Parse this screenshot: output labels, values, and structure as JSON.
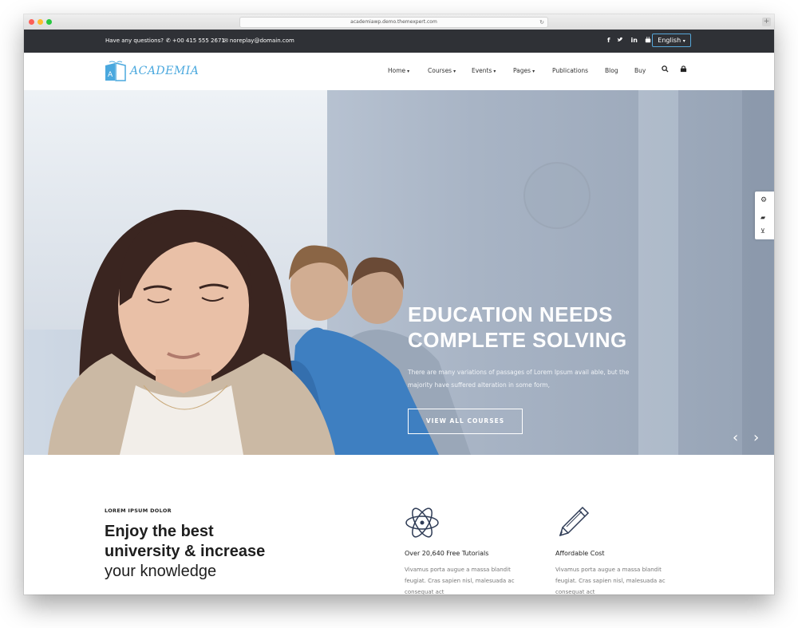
{
  "browser": {
    "url": "academiawp.demo.themexpert.com",
    "reload_icon": "reload-icon",
    "new_tab_label": "+"
  },
  "topbar": {
    "question": "Have any questions?",
    "phone": "+00 415 555 2671",
    "email": "noreplay@domain.com",
    "social": [
      "f",
      "t",
      "in",
      "yt"
    ],
    "language": "English"
  },
  "header": {
    "logo_text": "ACADEMIA",
    "nav": [
      {
        "label": "Home",
        "dropdown": true
      },
      {
        "label": "Courses",
        "dropdown": true
      },
      {
        "label": "Events",
        "dropdown": true
      },
      {
        "label": "Pages",
        "dropdown": true
      },
      {
        "label": "Publications",
        "dropdown": false
      },
      {
        "label": "Blog",
        "dropdown": false
      },
      {
        "label": "Buy",
        "dropdown": false
      }
    ],
    "search_icon": "search-icon",
    "cart_icon": "cart-icon"
  },
  "hero": {
    "title_line1": "EDUCATION NEEDS",
    "title_line2": "COMPLETE SOLVING",
    "text": "There are many variations of passages of Lorem Ipsum avail able, but the majority have suffered alteration in some form,",
    "button": "VIEW ALL COURSES"
  },
  "intro": {
    "eyebrow": "LOREM IPSUM DOLOR",
    "heading_bold_1": "Enjoy the best",
    "heading_bold_2": "university & increase",
    "heading_light": "your knowledge"
  },
  "features": [
    {
      "icon": "atom-icon",
      "title": "Over 20,640 Free Tutorials",
      "text": "Vivamus porta augue a massa blandit feugiat. Cras sapien nisl, malesuada ac consequat act"
    },
    {
      "icon": "pencil-icon",
      "title": "Affordable Cost",
      "text": "Vivamus porta augue a massa blandit feugiat. Cras sapien nisl, malesuada ac consequat act"
    }
  ],
  "colors": {
    "accent": "#4aa8de",
    "topbar_bg": "#2f3136"
  }
}
